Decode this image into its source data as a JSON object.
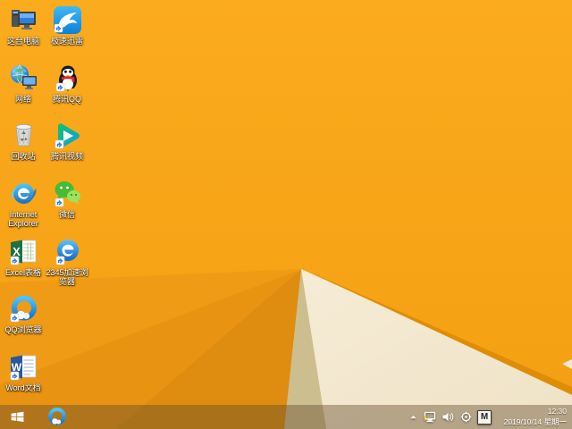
{
  "wallpaper": {
    "style": "windows-8.1-folded-paper",
    "colors": {
      "base_orange_top": "#FBAB1E",
      "base_orange_bottom": "#F49F12",
      "facet_1": "#F09B15",
      "facet_2": "#E89412",
      "facet_3": "#DF8D10",
      "khaki_shadow": "#CDBE90",
      "cream_light": "#F6ECD6",
      "cream_dark": "#EFE2C6",
      "ridge": "#DE8D06"
    }
  },
  "desktop": {
    "icons": [
      {
        "name": "this-pc",
        "label": "这台电脑"
      },
      {
        "name": "xunlei-speed",
        "label": "极速迅雷"
      },
      {
        "name": "network",
        "label": "网络"
      },
      {
        "name": "tencent-qq",
        "label": "腾讯QQ"
      },
      {
        "name": "recycle-bin",
        "label": "回收站"
      },
      {
        "name": "tencent-video",
        "label": "腾讯视频"
      },
      {
        "name": "internet-explorer",
        "label": "Internet Explorer"
      },
      {
        "name": "wechat",
        "label": "微信"
      },
      {
        "name": "excel",
        "label": "Excel表格"
      },
      {
        "name": "2345-browser",
        "label": "2345加速浏览器"
      },
      {
        "name": "qq-browser",
        "label": "QQ浏览器"
      },
      {
        "name": "word",
        "label": "Word文档"
      }
    ]
  },
  "taskbar": {
    "start_icon": "windows-logo",
    "pinned_icons": [
      "qq-browser"
    ],
    "tray": {
      "icons": [
        "show-hidden-chevron",
        "network-warning",
        "volume",
        "crosshair-app",
        "ime-indicator"
      ],
      "ime_letter": "M",
      "time": "12:30",
      "date": "2019/10/14 星期一"
    }
  }
}
